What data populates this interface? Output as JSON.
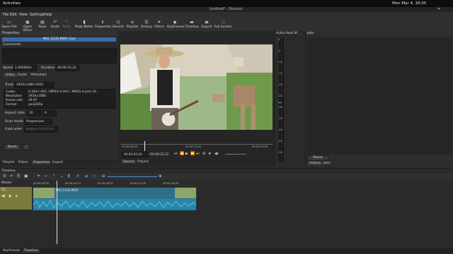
{
  "system": {
    "activities": "Activities",
    "clock": "Mon Mar 4, 16:05"
  },
  "window": {
    "title": "Untitled* - Shotcut"
  },
  "menu": [
    "File",
    "Edit",
    "View",
    "Settings",
    "Help"
  ],
  "toolbar": {
    "open_file": "Open File",
    "open_other": "Open Other",
    "save": "Save",
    "undo": "Undo",
    "redo": "Redo",
    "peak_meter": "Peak Meter",
    "properties": "Properties",
    "recent": "Recent",
    "playlist": "Playlist",
    "history": "History",
    "filters": "Filters",
    "keyframes": "Keyframes",
    "timeline": "Timeline",
    "export": "Export",
    "full_screen": "Full Screen"
  },
  "properties": {
    "header": "Properties",
    "clip_name": "MVI_5135.MOV (1x)",
    "comments_label": "Comments:",
    "speed_label": "Speed",
    "speed_value": "2.000000x",
    "duration_label": "Duration",
    "duration_value": "00:00:22;22",
    "tabs": [
      "Video",
      "Audio",
      "Metadata"
    ],
    "track_label": "Track",
    "track_value": "1920x1080 H264",
    "rows": [
      {
        "k": "Codec",
        "v": "H.264 / AVC / MPEG-4 AVC / MPEG-4 part 10"
      },
      {
        "k": "Resolution",
        "v": "1920x1080"
      },
      {
        "k": "Frame rate",
        "v": "29.97"
      },
      {
        "k": "Format",
        "v": "yuvj420p"
      }
    ],
    "aspect_label": "Aspect ratio",
    "aspect_w": "16",
    "aspect_h": "9",
    "scan_label": "Scan mode",
    "scan_value": "Progressive",
    "field_label": "Field order",
    "field_value": "Bottom Field First",
    "reset": "Reset"
  },
  "left_tabs": [
    "Playlist",
    "Filters",
    "Properties",
    "Export"
  ],
  "player": {
    "ruler": [
      "00:00:00;00",
      "00:00:10;00",
      "00:00:19;20"
    ],
    "current": "00:00:03;10",
    "total": "/ 00:00:22;22",
    "tabs": [
      "Source",
      "Project"
    ]
  },
  "audio_meter": {
    "header": "Audio Peak M...",
    "scale": [
      "0",
      "-5",
      "-10",
      "-15",
      "-20",
      "-25",
      "-30",
      "-35",
      "-40",
      "-45",
      "-50"
    ]
  },
  "jobs": {
    "header": "Jobs",
    "pause": "Pause",
    "tabs": [
      "History",
      "Jobs"
    ]
  },
  "timeline": {
    "header": "Timeline",
    "master": "Master",
    "track": "V1",
    "ruler": [
      "00:00:00;00",
      "00:00:04;13",
      "00:00:09;01",
      "00:00:13;18",
      "00:00:18;08"
    ],
    "clip_label": "MVI_5135.MOV"
  },
  "bottom_tabs": [
    "Keyframes",
    "Timeline"
  ]
}
